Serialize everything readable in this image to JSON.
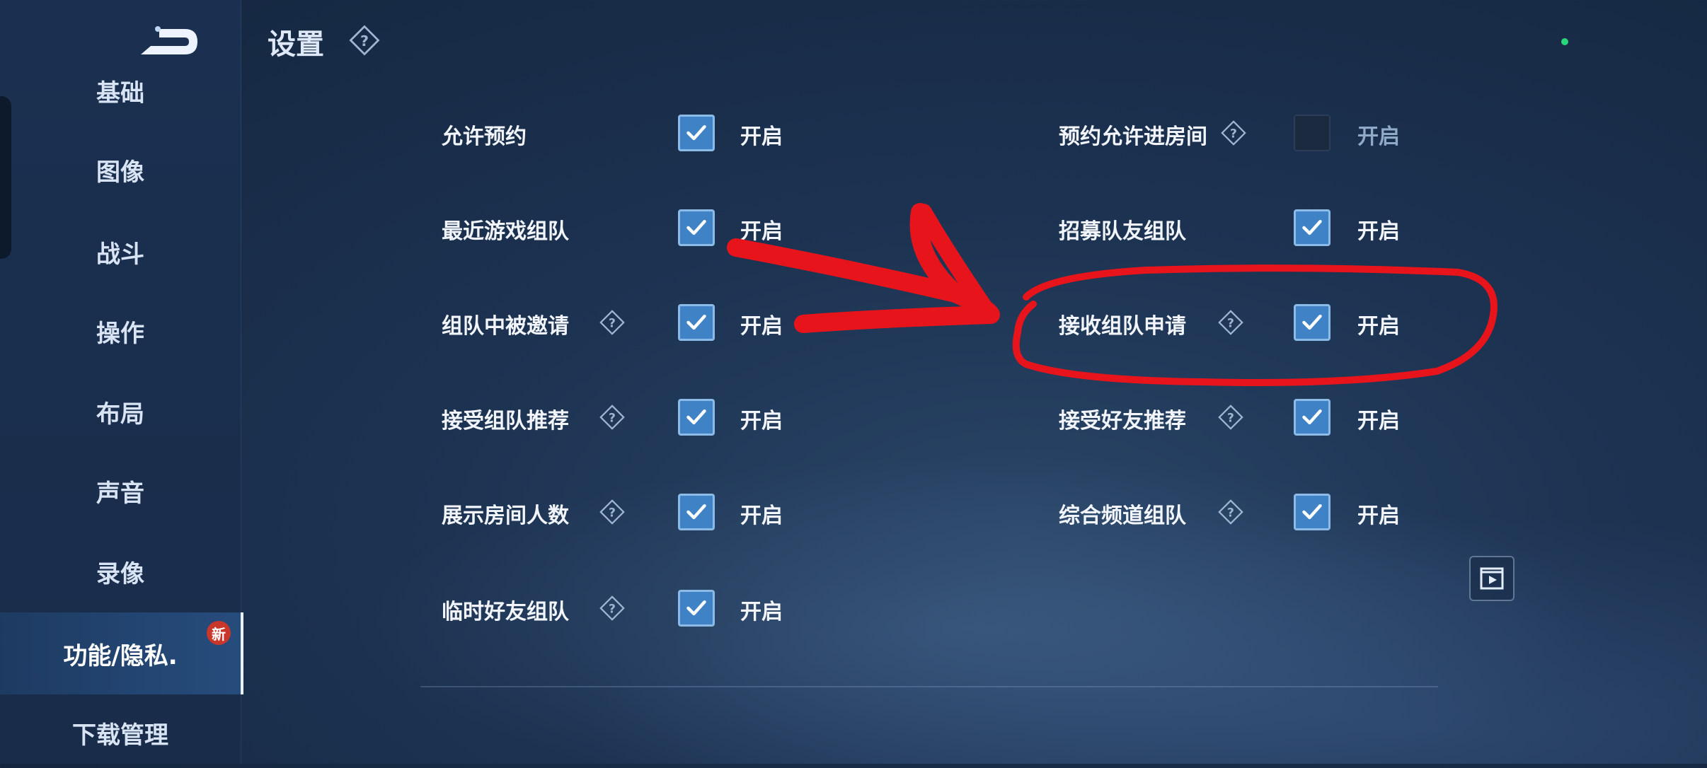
{
  "header": {
    "title": "设置"
  },
  "sidebar": {
    "items": [
      {
        "label": "基础"
      },
      {
        "label": "图像"
      },
      {
        "label": "战斗"
      },
      {
        "label": "操作"
      },
      {
        "label": "布局"
      },
      {
        "label": "声音"
      },
      {
        "label": "录像"
      },
      {
        "label": "功能/隐私."
      },
      {
        "label": "下载管理"
      }
    ],
    "active_index": 7,
    "new_badge": "新"
  },
  "settings": {
    "left": [
      {
        "label": "允许预约",
        "state": "开启",
        "checked": true,
        "help": false
      },
      {
        "label": "最近游戏组队",
        "state": "开启",
        "checked": true,
        "help": false
      },
      {
        "label": "组队中被邀请",
        "state": "开启",
        "checked": true,
        "help": true
      },
      {
        "label": "接受组队推荐",
        "state": "开启",
        "checked": true,
        "help": true
      },
      {
        "label": "展示房间人数",
        "state": "开启",
        "checked": true,
        "help": true
      },
      {
        "label": "临时好友组队",
        "state": "开启",
        "checked": true,
        "help": true
      }
    ],
    "right": [
      {
        "label": "预约允许进房间",
        "state": "开启",
        "checked": false,
        "help": true
      },
      {
        "label": "招募队友组队",
        "state": "开启",
        "checked": true,
        "help": false
      },
      {
        "label": "接收组队申请",
        "state": "开启",
        "checked": true,
        "help": true
      },
      {
        "label": "接受好友推荐",
        "state": "开启",
        "checked": true,
        "help": true
      },
      {
        "label": "综合频道组队",
        "state": "开启",
        "checked": true,
        "help": true
      }
    ]
  },
  "icons": {
    "back": "back-arrow-icon",
    "help": "question-diamond-icon",
    "check": "checkmark-icon",
    "replay": "video-replay-icon"
  },
  "colors": {
    "accent": "#3f83c6",
    "annotation": "#e8141b",
    "status_dot": "#29d67a"
  }
}
